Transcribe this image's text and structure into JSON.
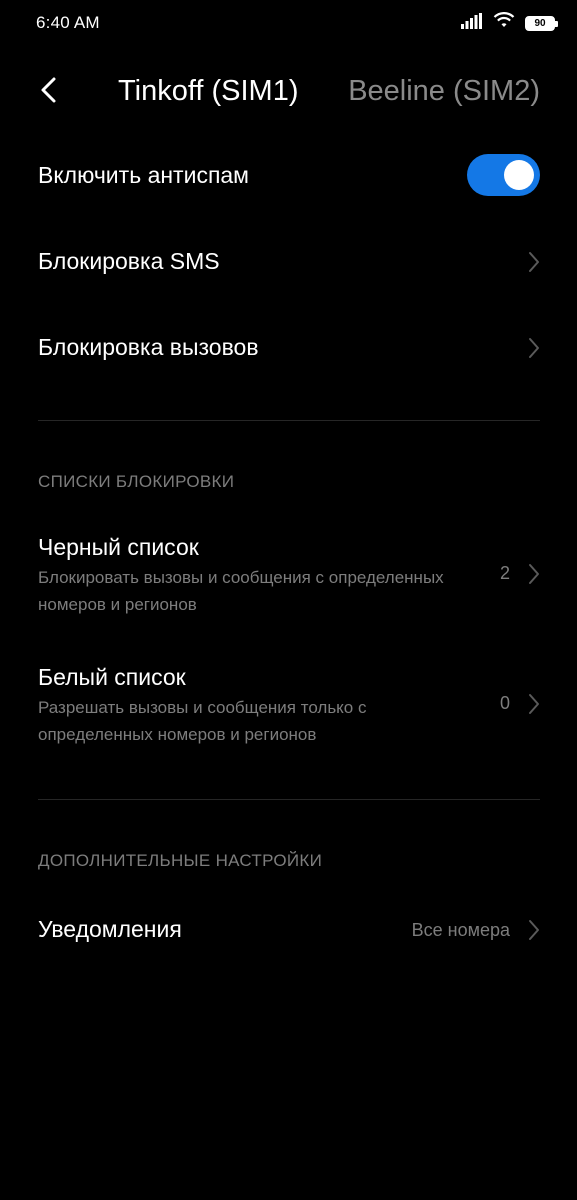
{
  "status_bar": {
    "time": "6:40 AM",
    "battery": "90",
    "icons": [
      "signal-icon",
      "wifi-icon",
      "battery-icon"
    ]
  },
  "header": {
    "tabs": [
      {
        "label": "Tinkoff (SIM1)",
        "active": true
      },
      {
        "label": "Beeline (SIM2)",
        "active": false
      }
    ]
  },
  "settings": {
    "antispam": {
      "label": "Включить антиспам",
      "enabled": true
    },
    "sms_block": {
      "label": "Блокировка SMS"
    },
    "call_block": {
      "label": "Блокировка вызовов"
    }
  },
  "block_lists": {
    "header": "СПИСКИ БЛОКИРОВКИ",
    "blacklist": {
      "title": "Черный список",
      "subtitle": "Блокировать вызовы и сообщения с определенных номеров и регионов",
      "count": "2"
    },
    "whitelist": {
      "title": "Белый список",
      "subtitle": "Разрешать вызовы и сообщения только с определенных номеров и регионов",
      "count": "0"
    }
  },
  "additional": {
    "header": "ДОПОЛНИТЕЛЬНЫЕ НАСТРОЙКИ",
    "notifications": {
      "title": "Уведомления",
      "value": "Все номера"
    }
  },
  "colors": {
    "background": "#000000",
    "toggle_on": "#1478e6",
    "secondary_text": "#7d7d7d",
    "inactive_tab": "#8a8a8a"
  }
}
